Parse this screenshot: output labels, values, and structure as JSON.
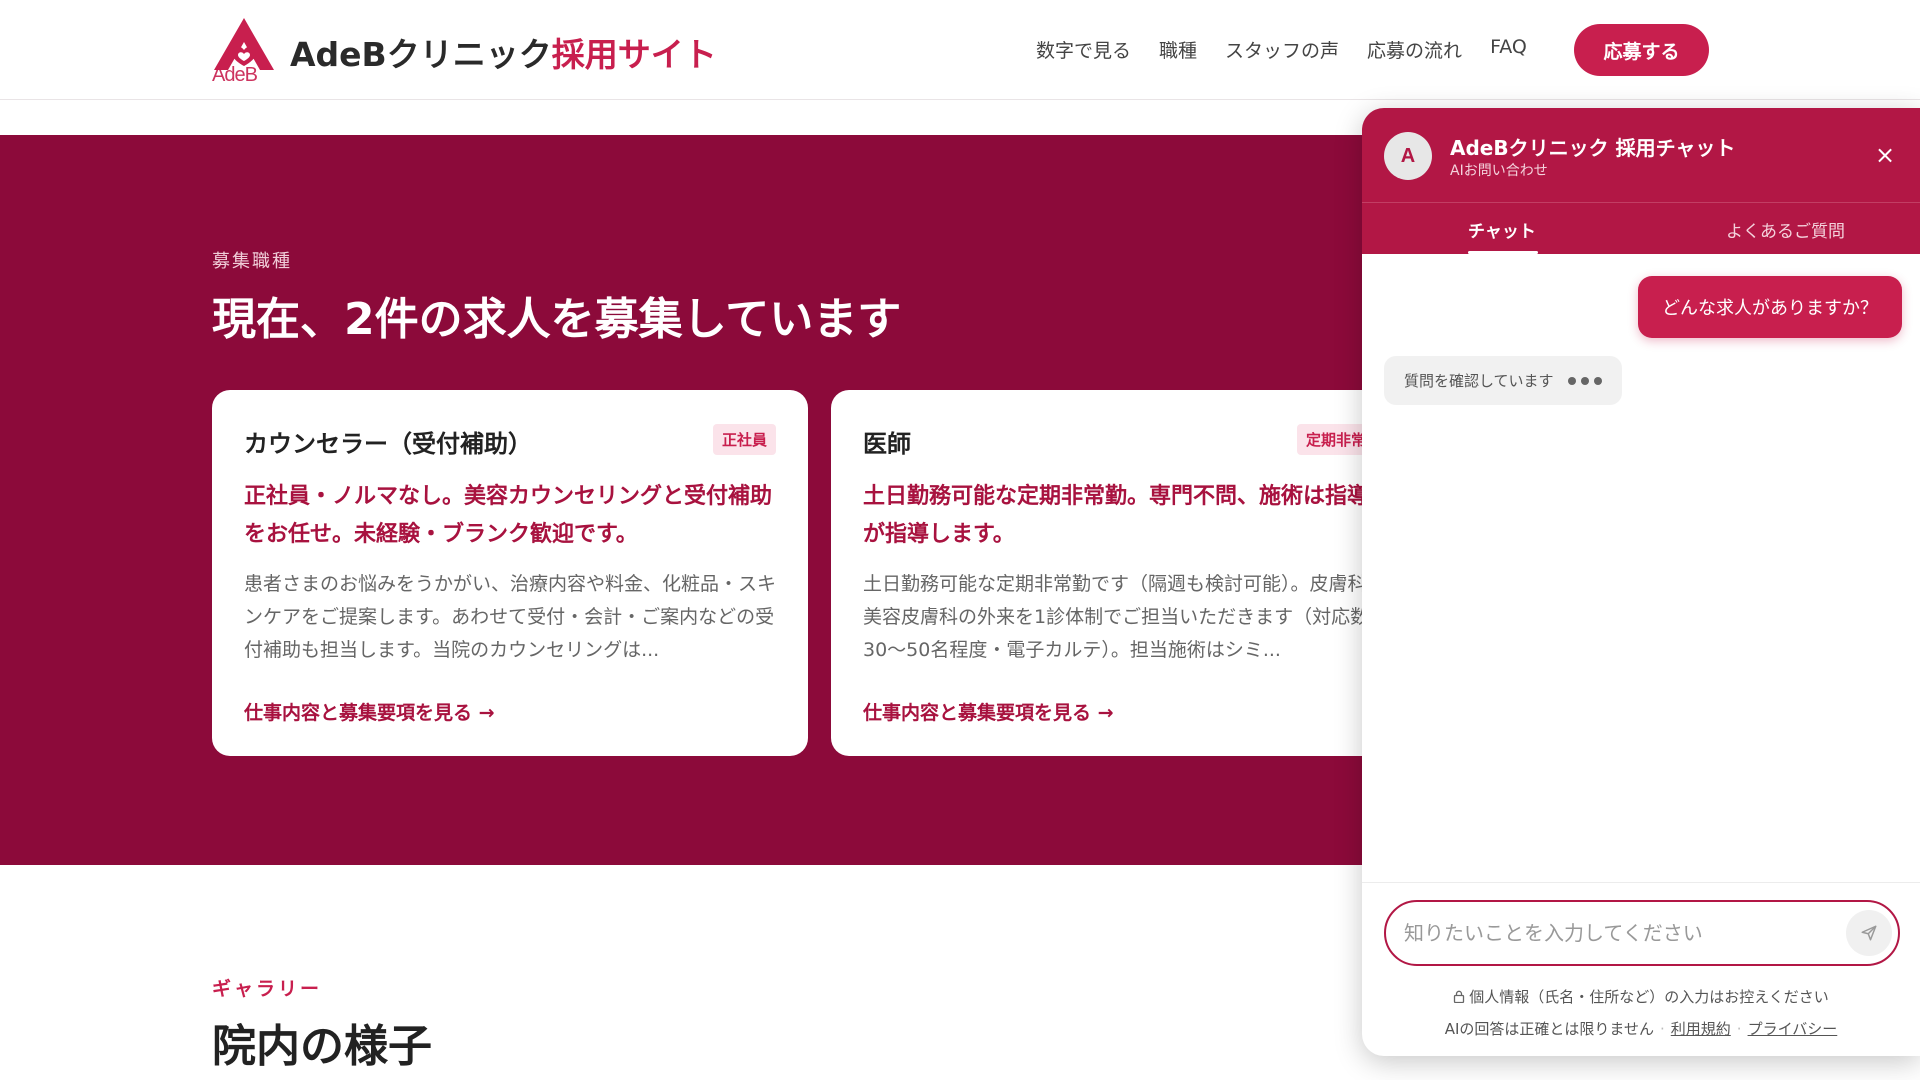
{
  "header": {
    "brand_main": "AdeBクリニック",
    "brand_accent": "採用サイト",
    "logo_sub": "AdeB",
    "nav": [
      "数字で見る",
      "職種",
      "スタッフの声",
      "応募の流れ",
      "FAQ"
    ],
    "apply_label": "応募する"
  },
  "jobs": {
    "eyebrow": "募集職種",
    "title": "現在、2件の求人を募集しています",
    "cards": [
      {
        "title": "カウンセラー（受付補助）",
        "badge": "正社員",
        "lead": "正社員・ノルマなし。美容カウンセリングと受付補助をお任せ。未経験・ブランク歓迎です。",
        "desc": "患者さまのお悩みをうかがい、治療内容や料金、化粧品・スキンケアをご提案します。あわせて受付・会計・ご案内などの受付補助も担当します。当院のカウンセリングは...",
        "link": "仕事内容と募集要項を見る →"
      },
      {
        "title": "医師",
        "badge": "定期非常勤",
        "lead": "土日勤務可能な定期非常勤。専門不問、施術は指導医が指導します。",
        "desc": "土日勤務可能な定期非常勤です（隔週も検討可能）。皮膚科・美容皮膚科の外来を1診体制でご担当いただきます（対応数30〜50名程度・電子カルテ）。担当施術はシミ...",
        "link": "仕事内容と募集要項を見る →"
      }
    ]
  },
  "gallery": {
    "eyebrow": "ギャラリー",
    "title": "院内の様子"
  },
  "chat": {
    "avatar": "A",
    "title": "AdeBクリニック 採用チャット",
    "subtitle": "AIお問い合わせ",
    "close": "×",
    "tabs": [
      "チャット",
      "よくあるご質問"
    ],
    "user_message": "どんな求人がありますか？",
    "bot_status": "質問を確認しています",
    "input_placeholder": "知りたいことを入力してください",
    "privacy_note": "個人情報（氏名・住所など）の入力はお控えください",
    "disclaimer": "AIの回答は正確とは限りません",
    "terms": "利用規約",
    "privacy": "プライバシー"
  },
  "colors": {
    "brand": "#c81f4e",
    "section_bg": "#8c0a3a",
    "chat_header": "#b21745"
  }
}
